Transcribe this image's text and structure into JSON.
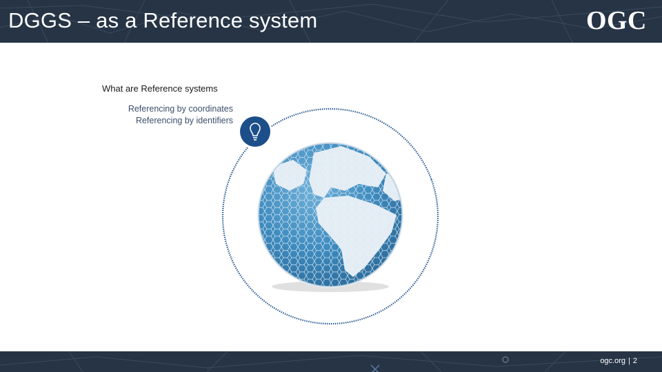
{
  "header": {
    "title": "DGGS – as a Reference system",
    "logo_text": "OGC",
    "background_color": "#263445"
  },
  "content": {
    "heading": "What are Reference systems",
    "bullets": [
      "Referencing by coordinates",
      "Referencing by identifiers"
    ],
    "icons": [
      "lightbulb-icon",
      "dggs-globe"
    ],
    "accent_color": "#1c4f8a"
  },
  "footer": {
    "site": "ogc.org",
    "page_number": "2"
  }
}
